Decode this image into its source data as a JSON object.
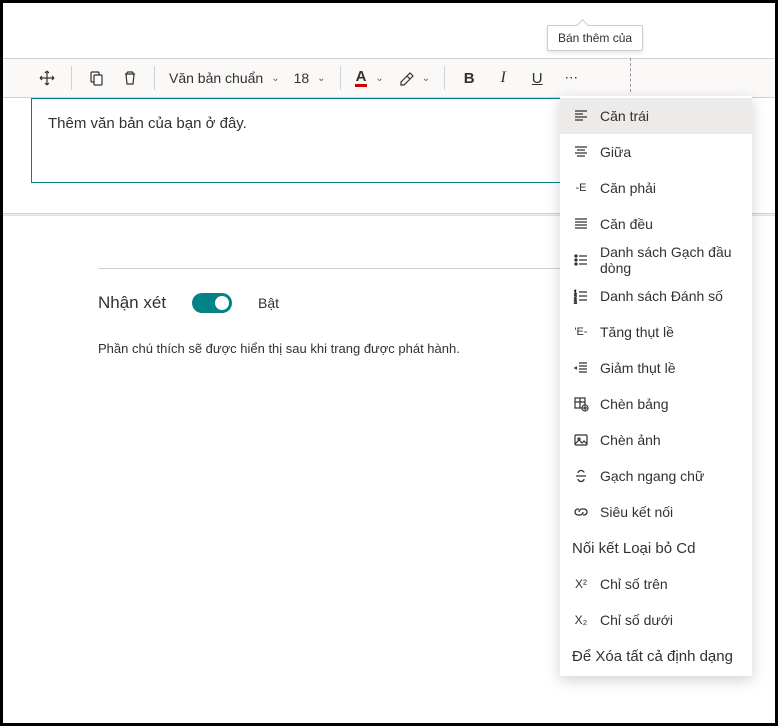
{
  "tooltip": "Bán thêm của",
  "toolbar": {
    "text_style": "Văn bản chuẩn",
    "font_size": "18",
    "font_color_letter": "A",
    "bold_letter": "B",
    "italic_letter": "I",
    "underline_letter": "U",
    "more": "⋯"
  },
  "editor": {
    "placeholder": "Thêm văn bản của bạn ở đây."
  },
  "comments": {
    "title": "Nhận xét",
    "toggle_state": "Bật",
    "note": "Phần chú thích sẽ được hiển thị sau khi trang được phát hành."
  },
  "menu": {
    "align_left": "Căn trái",
    "align_center": "Giữa",
    "align_right": "Căn phải",
    "justify": "Căn đều",
    "bullet_list": "Danh sách Gạch đầu dòng",
    "number_list": "Danh sách Đánh số",
    "indent": "Tăng thụt lề",
    "outdent": "Giảm thụt lề",
    "insert_table": "Chèn bảng",
    "insert_image": "Chèn ảnh",
    "strikethrough": "Gạch ngang chữ",
    "hyperlink": "Siêu kết nối",
    "remove_link": "Nối kết Loại bỏ Cd",
    "superscript": "Chỉ số trên",
    "subscript": "Chỉ số dưới",
    "clear_format": "Để Xóa tất cả định dạng"
  }
}
